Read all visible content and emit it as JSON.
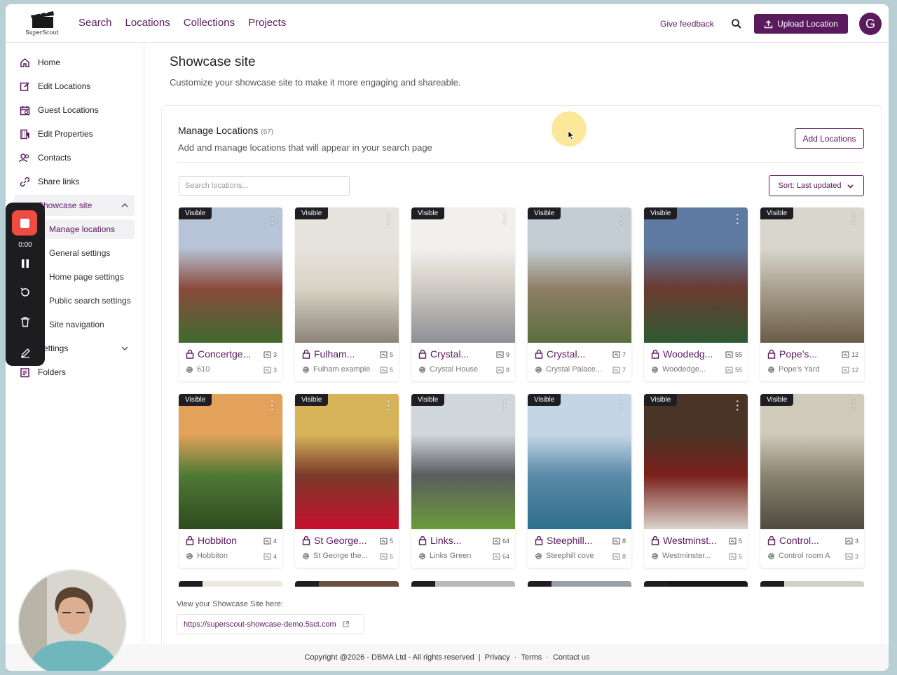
{
  "app": {
    "logo_text": "SuperScout",
    "nav": [
      "Search",
      "Locations",
      "Collections",
      "Projects"
    ],
    "feedback": "Give feedback",
    "upload": "Upload Location",
    "avatar_initial": "G"
  },
  "sidebar": {
    "items": [
      {
        "label": "Home",
        "icon": "home-icon"
      },
      {
        "label": "Edit Locations",
        "icon": "edit-icon"
      },
      {
        "label": "Guest Locations",
        "icon": "calendar-icon"
      },
      {
        "label": "Edit Properties",
        "icon": "building-icon"
      },
      {
        "label": "Contacts",
        "icon": "contacts-icon"
      },
      {
        "label": "Share links",
        "icon": "link-icon"
      },
      {
        "label": "Showcase site",
        "icon": "showcase-icon"
      },
      {
        "label": "Settings",
        "icon": "settings-icon"
      },
      {
        "label": "Folders",
        "icon": "folder-icon"
      }
    ],
    "sub_items": [
      "Manage locations",
      "General settings",
      "Home page settings",
      "Public search settings",
      "Site navigation"
    ]
  },
  "recorder": {
    "time": "0:00"
  },
  "page": {
    "title": "Showcase site",
    "subtitle": "Customize your showcase site to make it more engaging and shareable."
  },
  "manage": {
    "title": "Manage Locations",
    "count": "(67)",
    "subtitle": "Add and manage locations that will appear in your search page",
    "add_button": "Add Locations",
    "search_placeholder": "Search locations...",
    "sort_label": "Sort: Last updated"
  },
  "badge_label": "Visible",
  "locations": [
    {
      "name": "Concertge...",
      "sub": "610",
      "count": "3",
      "count2": "3",
      "colors": [
        "#b7c3d6",
        "#8a4a3c",
        "#3f6b2e"
      ]
    },
    {
      "name": "Fulham...",
      "sub": "Fulham example",
      "count": "5",
      "count2": "5",
      "colors": [
        "#e6e3dc",
        "#d9d3c6",
        "#8c8478"
      ]
    },
    {
      "name": "Crystal...",
      "sub": "Crystal House",
      "count": "9",
      "count2": "8",
      "colors": [
        "#f1f0ed",
        "#cfcac1",
        "#8c8f94"
      ]
    },
    {
      "name": "Crystal...",
      "sub": "Crystal Palace...",
      "count": "7",
      "count2": "7",
      "colors": [
        "#c4cdd4",
        "#8f7e67",
        "#5b6e3c"
      ]
    },
    {
      "name": "Woodedg...",
      "sub": "Woodedge...",
      "count": "55",
      "count2": "55",
      "colors": [
        "#5e7aa0",
        "#6b3a2f",
        "#2c5a30"
      ]
    },
    {
      "name": "Pope's...",
      "sub": "Pope's Yard",
      "count": "12",
      "count2": "12",
      "colors": [
        "#d9d6cd",
        "#a9a08e",
        "#6a5d46"
      ]
    },
    {
      "name": "Hobbiton",
      "sub": "Hobbiton",
      "count": "4",
      "count2": "4",
      "colors": [
        "#e2a25a",
        "#4f7a35",
        "#2e4a1f"
      ]
    },
    {
      "name": "St George...",
      "sub": "St George the...",
      "count": "5",
      "count2": "5",
      "colors": [
        "#d7b35a",
        "#7a3a2a",
        "#c8102e"
      ]
    },
    {
      "name": "Links...",
      "sub": "Links Green",
      "count": "64",
      "count2": "64",
      "colors": [
        "#cfd6dc",
        "#5a5c60",
        "#6a9b3a"
      ]
    },
    {
      "name": "Steephill...",
      "sub": "Steephill cove",
      "count": "8",
      "count2": "8",
      "colors": [
        "#c4d6e6",
        "#5a8aa8",
        "#2f6f8a"
      ]
    },
    {
      "name": "Westminst...",
      "sub": "Westminster...",
      "count": "5",
      "count2": "5",
      "colors": [
        "#4a3425",
        "#7a1f1a",
        "#d8d4cc"
      ]
    },
    {
      "name": "Control...",
      "sub": "Control room A",
      "count": "3",
      "count2": "3",
      "colors": [
        "#cfcab9",
        "#8a8470",
        "#4e4a3e"
      ]
    }
  ],
  "showcase_link": {
    "label": "View your Showcase Site here:",
    "url": "https://superscout-showcase-demo.5sct.com"
  },
  "footer": {
    "copyright": "Copyright @2026 - DBMA Ltd - All rights reserved",
    "links": [
      "Privacy",
      "Terms",
      "Contact us"
    ]
  },
  "colors": {
    "brand": "#5a1a5e",
    "record": "#ee4b43"
  }
}
